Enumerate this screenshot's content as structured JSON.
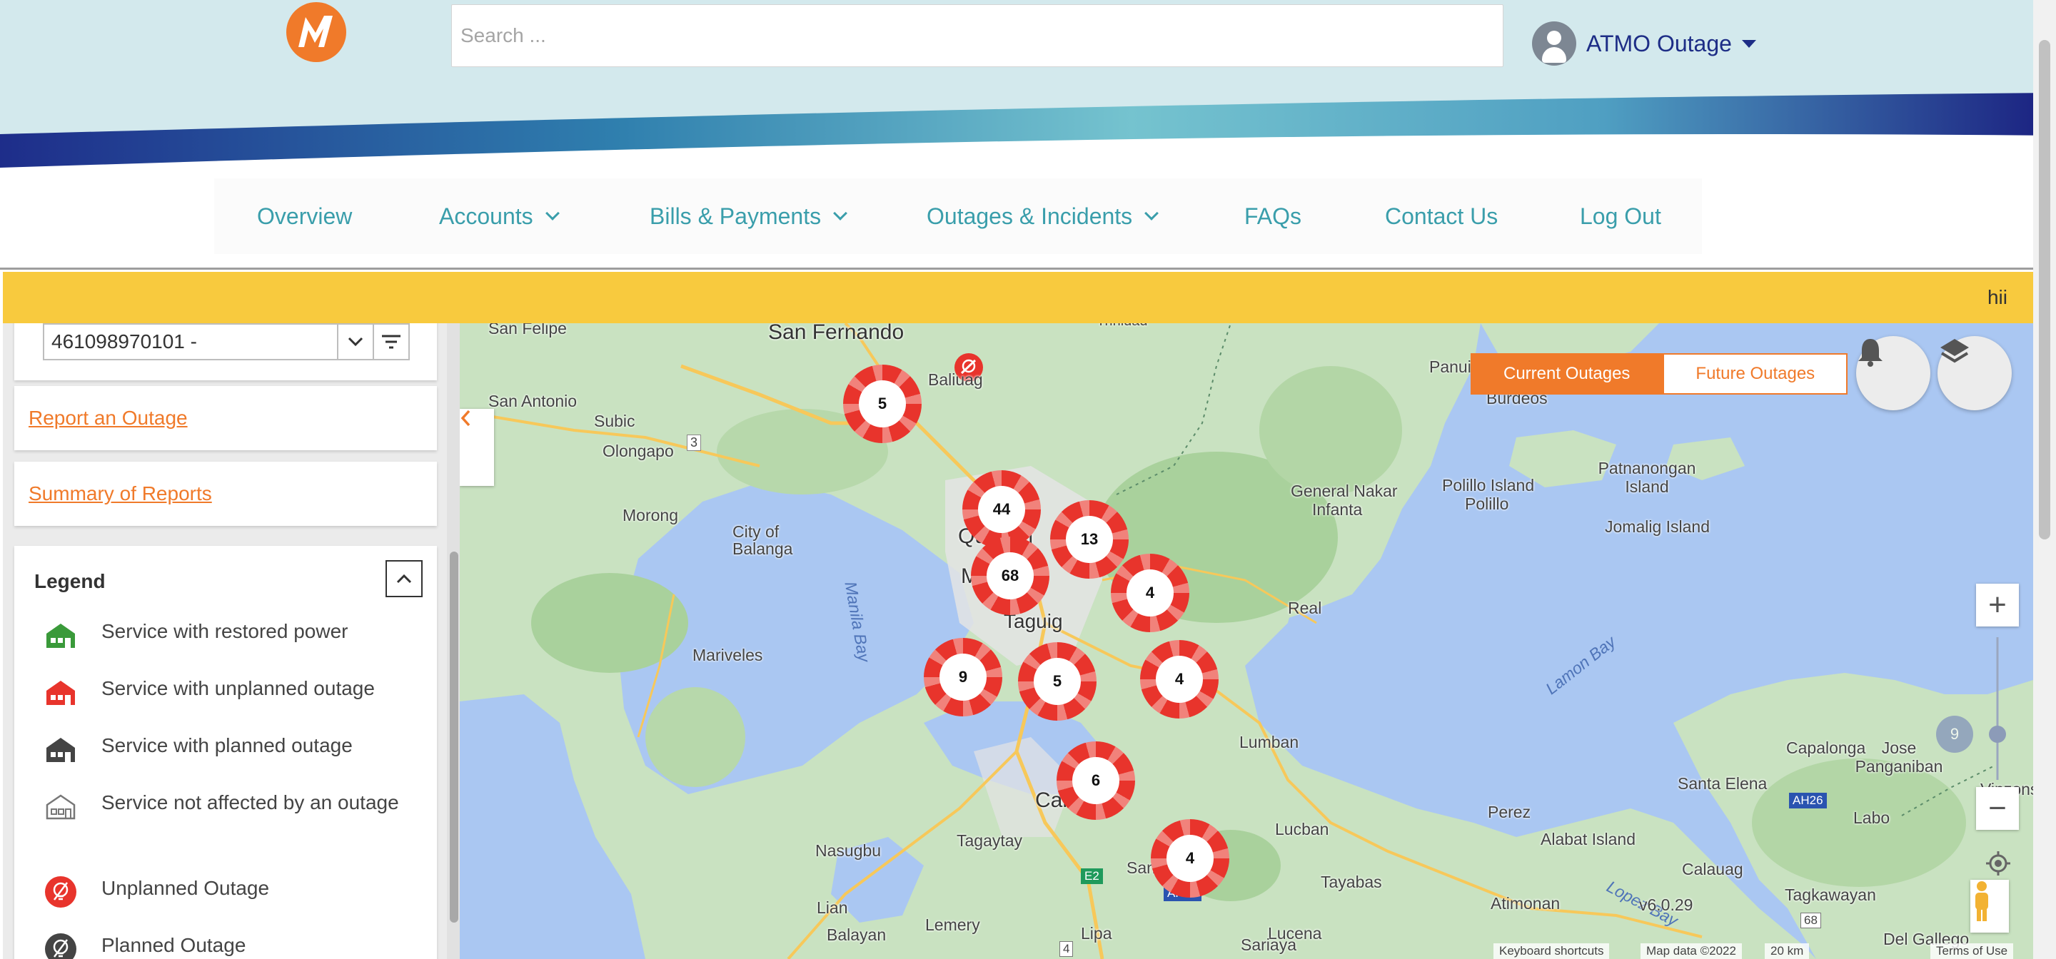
{
  "header": {
    "logo_alt": "M",
    "search_placeholder": "Search ...",
    "user_name": "ATMO Outage"
  },
  "nav": {
    "items": [
      {
        "label": "Overview"
      },
      {
        "label": "Accounts"
      },
      {
        "label": "Bills & Payments"
      },
      {
        "label": "Outages & Incidents"
      },
      {
        "label": "FAQs"
      },
      {
        "label": "Contact Us"
      },
      {
        "label": "Log Out"
      }
    ]
  },
  "banner": {
    "text": "hii"
  },
  "sidebar": {
    "account_value": "461098970101 -",
    "report_link": "Report an Outage",
    "summary_link": "Summary of Reports",
    "legend_title": "Legend",
    "legend_items": [
      {
        "label": "Service with restored power",
        "icon": "house-green-icon",
        "color": "#3a9a3a"
      },
      {
        "label": "Service with unplanned outage",
        "icon": "house-red-icon",
        "color": "#e8342c"
      },
      {
        "label": "Service with planned outage",
        "icon": "house-dark-icon",
        "color": "#444444"
      },
      {
        "label": "Service not affected by an outage",
        "icon": "house-outline-icon",
        "color": "#777777"
      },
      {
        "label": "Unplanned Outage",
        "icon": "unplanned-pin-icon",
        "color": "#e8342c"
      },
      {
        "label": "Planned Outage",
        "icon": "planned-pin-icon",
        "color": "#444444"
      }
    ]
  },
  "map": {
    "tabs": {
      "current": "Current Outages",
      "future": "Future Outages"
    },
    "clusters": [
      "5",
      "44",
      "13",
      "68",
      "4",
      "9",
      "5",
      "4",
      "6",
      "4"
    ],
    "faded_cluster": "9",
    "places": [
      "San Fernando",
      "San Felipe",
      "Baliuag",
      "San Antonio",
      "Subic",
      "Olongapo",
      "3",
      "Morong",
      "City of Balanga",
      "Mariveles",
      "Manila Bay",
      "Quezon",
      "Manila",
      "Taguig",
      "General Nakar",
      "Infanta",
      "Real",
      "Polillo Island",
      "Polillo",
      "Patnanongan Island",
      "Jomalig Island",
      "Burdeos",
      "Panui",
      "Lamon Bay",
      "Lumban",
      "Calamba",
      "Nasugbu",
      "Tagaytay",
      "San Pablo",
      "Lucban",
      "Tayabas",
      "Lucena",
      "Perez",
      "Alabat Island",
      "Atimonan",
      "Lopez Bay",
      "Calauag",
      "Santa Elena",
      "Capalonga",
      "Jose Panganiban",
      "Labo",
      "Tagkawayan",
      "Del Gallego",
      "Vinzons",
      "Lian",
      "Balayan",
      "Lemery",
      "Lipa",
      "Sariaya",
      "E2",
      "AH26",
      "AH26",
      "68",
      "4",
      "Trinidad",
      "v6.0.29"
    ],
    "attribution": {
      "shortcuts": "Keyboard shortcuts",
      "data": "Map data ©2022",
      "scale": "20 km",
      "terms": "Terms of Use"
    }
  },
  "colors": {
    "accent": "#f07a2a",
    "teal": "#3a9eab",
    "navy": "#1d2d86",
    "banner": "#f8ca3e",
    "cluster_red": "#e8342c"
  }
}
